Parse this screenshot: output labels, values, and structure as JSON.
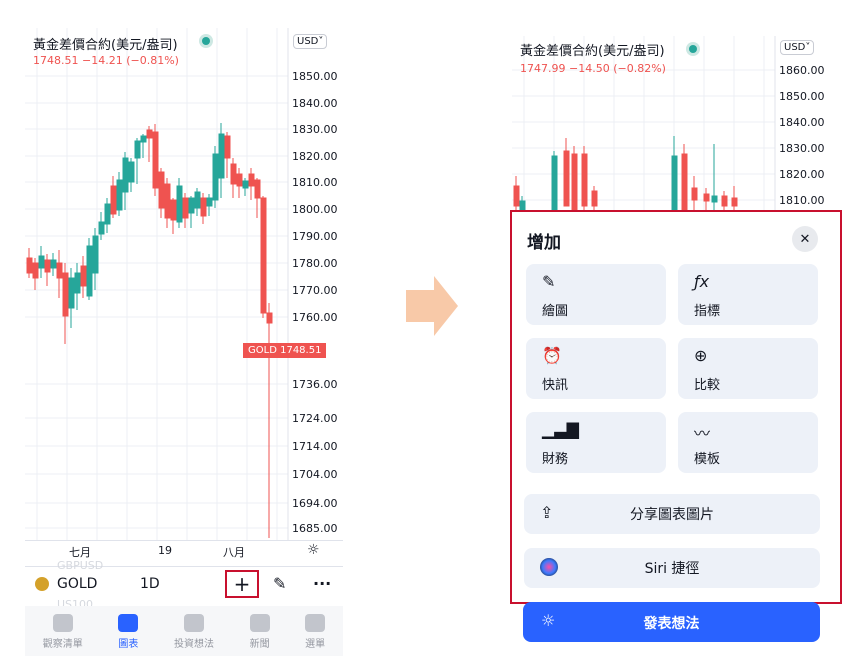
{
  "left": {
    "symbol_title": "黃金差價合約(美元/盎司)",
    "price_line": "1748.51  −14.21 (−0.81%)",
    "currency": "USD",
    "price_ticks": [
      "1850.00",
      "1840.00",
      "1830.00",
      "1820.00",
      "1810.00",
      "1800.00",
      "1790.00",
      "1780.00",
      "1770.00",
      "1760.00",
      "1736.00",
      "1724.00",
      "1714.00",
      "1704.00",
      "1694.00",
      "1685.00"
    ],
    "current_label": "GOLD",
    "current_price": "1748.51",
    "x_labels": [
      "七月",
      "19",
      "八月"
    ],
    "toolbar": {
      "symbol": "GOLD",
      "interval": "1D"
    },
    "ghost_texts": [
      "GBPUSD",
      "US100"
    ],
    "tabs": [
      "觀察清單",
      "圖表",
      "投資想法",
      "新聞",
      "選單"
    ]
  },
  "right": {
    "symbol_title": "黃金差價合約(美元/盎司)",
    "price_line": "1747.99  −14.50 (−0.82%)",
    "currency": "USD",
    "price_ticks": [
      "1860.00",
      "1850.00",
      "1840.00",
      "1830.00",
      "1820.00",
      "1810.00"
    ],
    "sheet": {
      "title": "增加",
      "items": [
        "繪圖",
        "指標",
        "快訊",
        "比較",
        "財務",
        "模板"
      ],
      "share": "分享圖表圖片",
      "siri": "Siri 捷徑",
      "publish": "發表想法"
    }
  },
  "colors": {
    "up": "#26a69a",
    "down": "#ef5350",
    "accent": "#2962ff",
    "highlight": "#c8102e"
  }
}
